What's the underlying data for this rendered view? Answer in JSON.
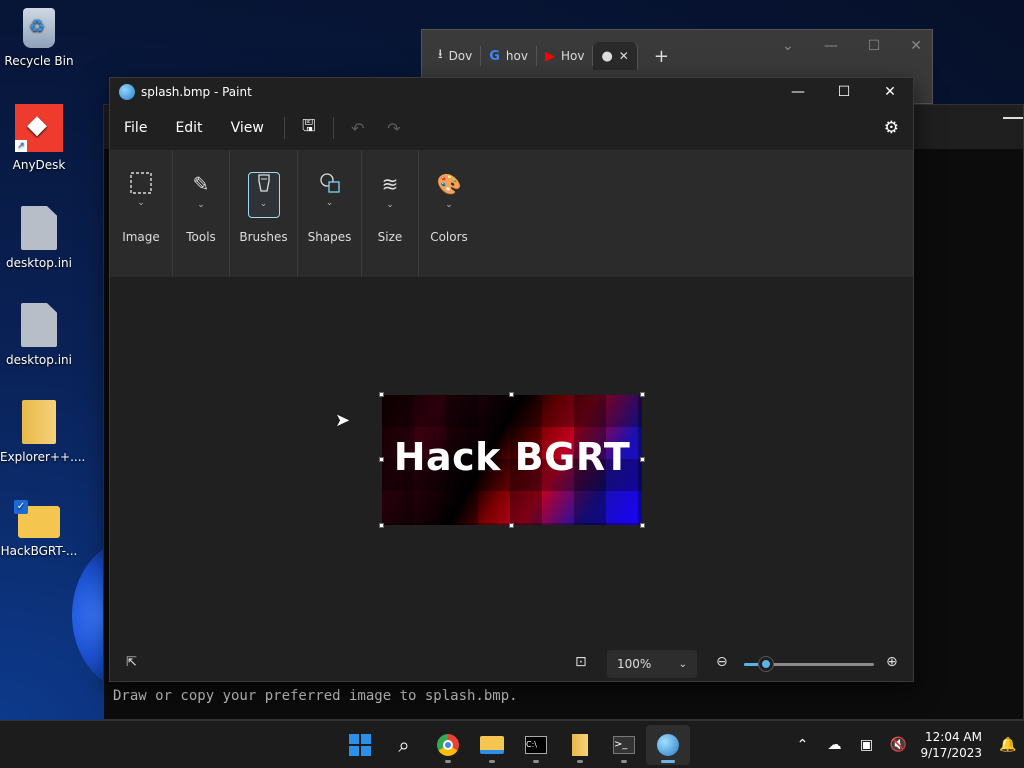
{
  "desktop": {
    "icons": [
      {
        "label": "Recycle Bin",
        "icon": "recycle-bin-icon"
      },
      {
        "label": "AnyDesk",
        "icon": "anydesk-icon"
      },
      {
        "label": "desktop.ini",
        "icon": "settings-file-icon"
      },
      {
        "label": "desktop.ini",
        "icon": "settings-file-icon"
      },
      {
        "label": "Explorer++....",
        "icon": "zip-folder-icon"
      },
      {
        "label": "HackBGRT-...",
        "icon": "folder-icon"
      }
    ]
  },
  "browser": {
    "tabs": [
      {
        "label": "Dov",
        "icon": "download-icon"
      },
      {
        "label": "hov",
        "icon": "google-icon"
      },
      {
        "label": "Hov",
        "icon": "youtube-icon"
      },
      {
        "label": "",
        "icon": "github-icon"
      }
    ],
    "new_tab": "+"
  },
  "terminal": {
    "visible_line": "Draw or copy your preferred image to splash.bmp."
  },
  "paint": {
    "title": "splash.bmp - Paint",
    "menu": [
      "File",
      "Edit",
      "View"
    ],
    "ribbon": [
      {
        "label": "Image",
        "icon": "select-icon"
      },
      {
        "label": "Tools",
        "icon": "tools-icon"
      },
      {
        "label": "Brushes",
        "icon": "brush-icon"
      },
      {
        "label": "Shapes",
        "icon": "shapes-icon"
      },
      {
        "label": "Size",
        "icon": "size-icon"
      },
      {
        "label": "Colors",
        "icon": "palette-icon"
      }
    ],
    "selected_tool": "Brushes",
    "image_text": "Hack BGRT",
    "zoom": "100%",
    "zoom_slider_fraction": 0.17
  },
  "taskbar": {
    "apps": [
      "start",
      "search",
      "chrome",
      "file-explorer",
      "terminal",
      "archive",
      "terminal-2",
      "paint"
    ],
    "active_app": "paint",
    "time": "12:04 AM",
    "date": "9/17/2023"
  },
  "colors": {
    "accent": "#58b3e6",
    "paint_bg": "#202020",
    "ribbon_bg": "#2b2b2b"
  }
}
